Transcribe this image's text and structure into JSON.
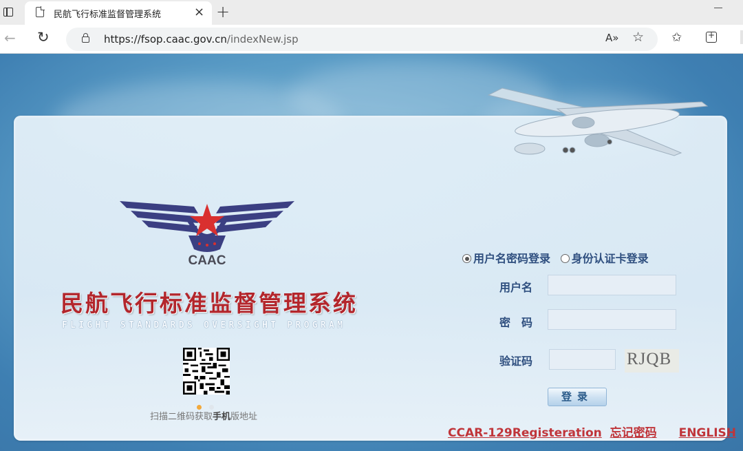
{
  "browser": {
    "tab_title": "民航飞行标准监督管理系统",
    "tab_close": "×",
    "new_tab": "+",
    "url_host": "https://fsop.caac.gov.cn",
    "url_path": "/indexNew.jsp",
    "read_aloud": "A»"
  },
  "logo": {
    "text": "CAAC"
  },
  "system": {
    "title": "民航飞行标准监督管理系统",
    "subtitle": "FLIGHT STANDARDS OVERSIGHT PROGRAM"
  },
  "qr": {
    "caption_prefix": "扫描二维码获取",
    "caption_bold": "手机",
    "caption_suffix": "版地址"
  },
  "login": {
    "options": [
      {
        "label": "用户名密码登录",
        "selected": true
      },
      {
        "label": "身份认证卡登录",
        "selected": false
      }
    ],
    "username_label": "用户名",
    "username_value": "",
    "password_label": "密　码",
    "password_value": "",
    "captcha_label": "验证码",
    "captcha_value": "",
    "captcha_image_text": "RJQB",
    "submit": "登录"
  },
  "footer": {
    "registration": "CCAR-129Registeration",
    "forgot": "忘记密码",
    "english": "ENGLISH"
  },
  "colors": {
    "title_red": "#b3262c",
    "label_blue": "#2f4f7f",
    "link_red": "#c0353a"
  }
}
